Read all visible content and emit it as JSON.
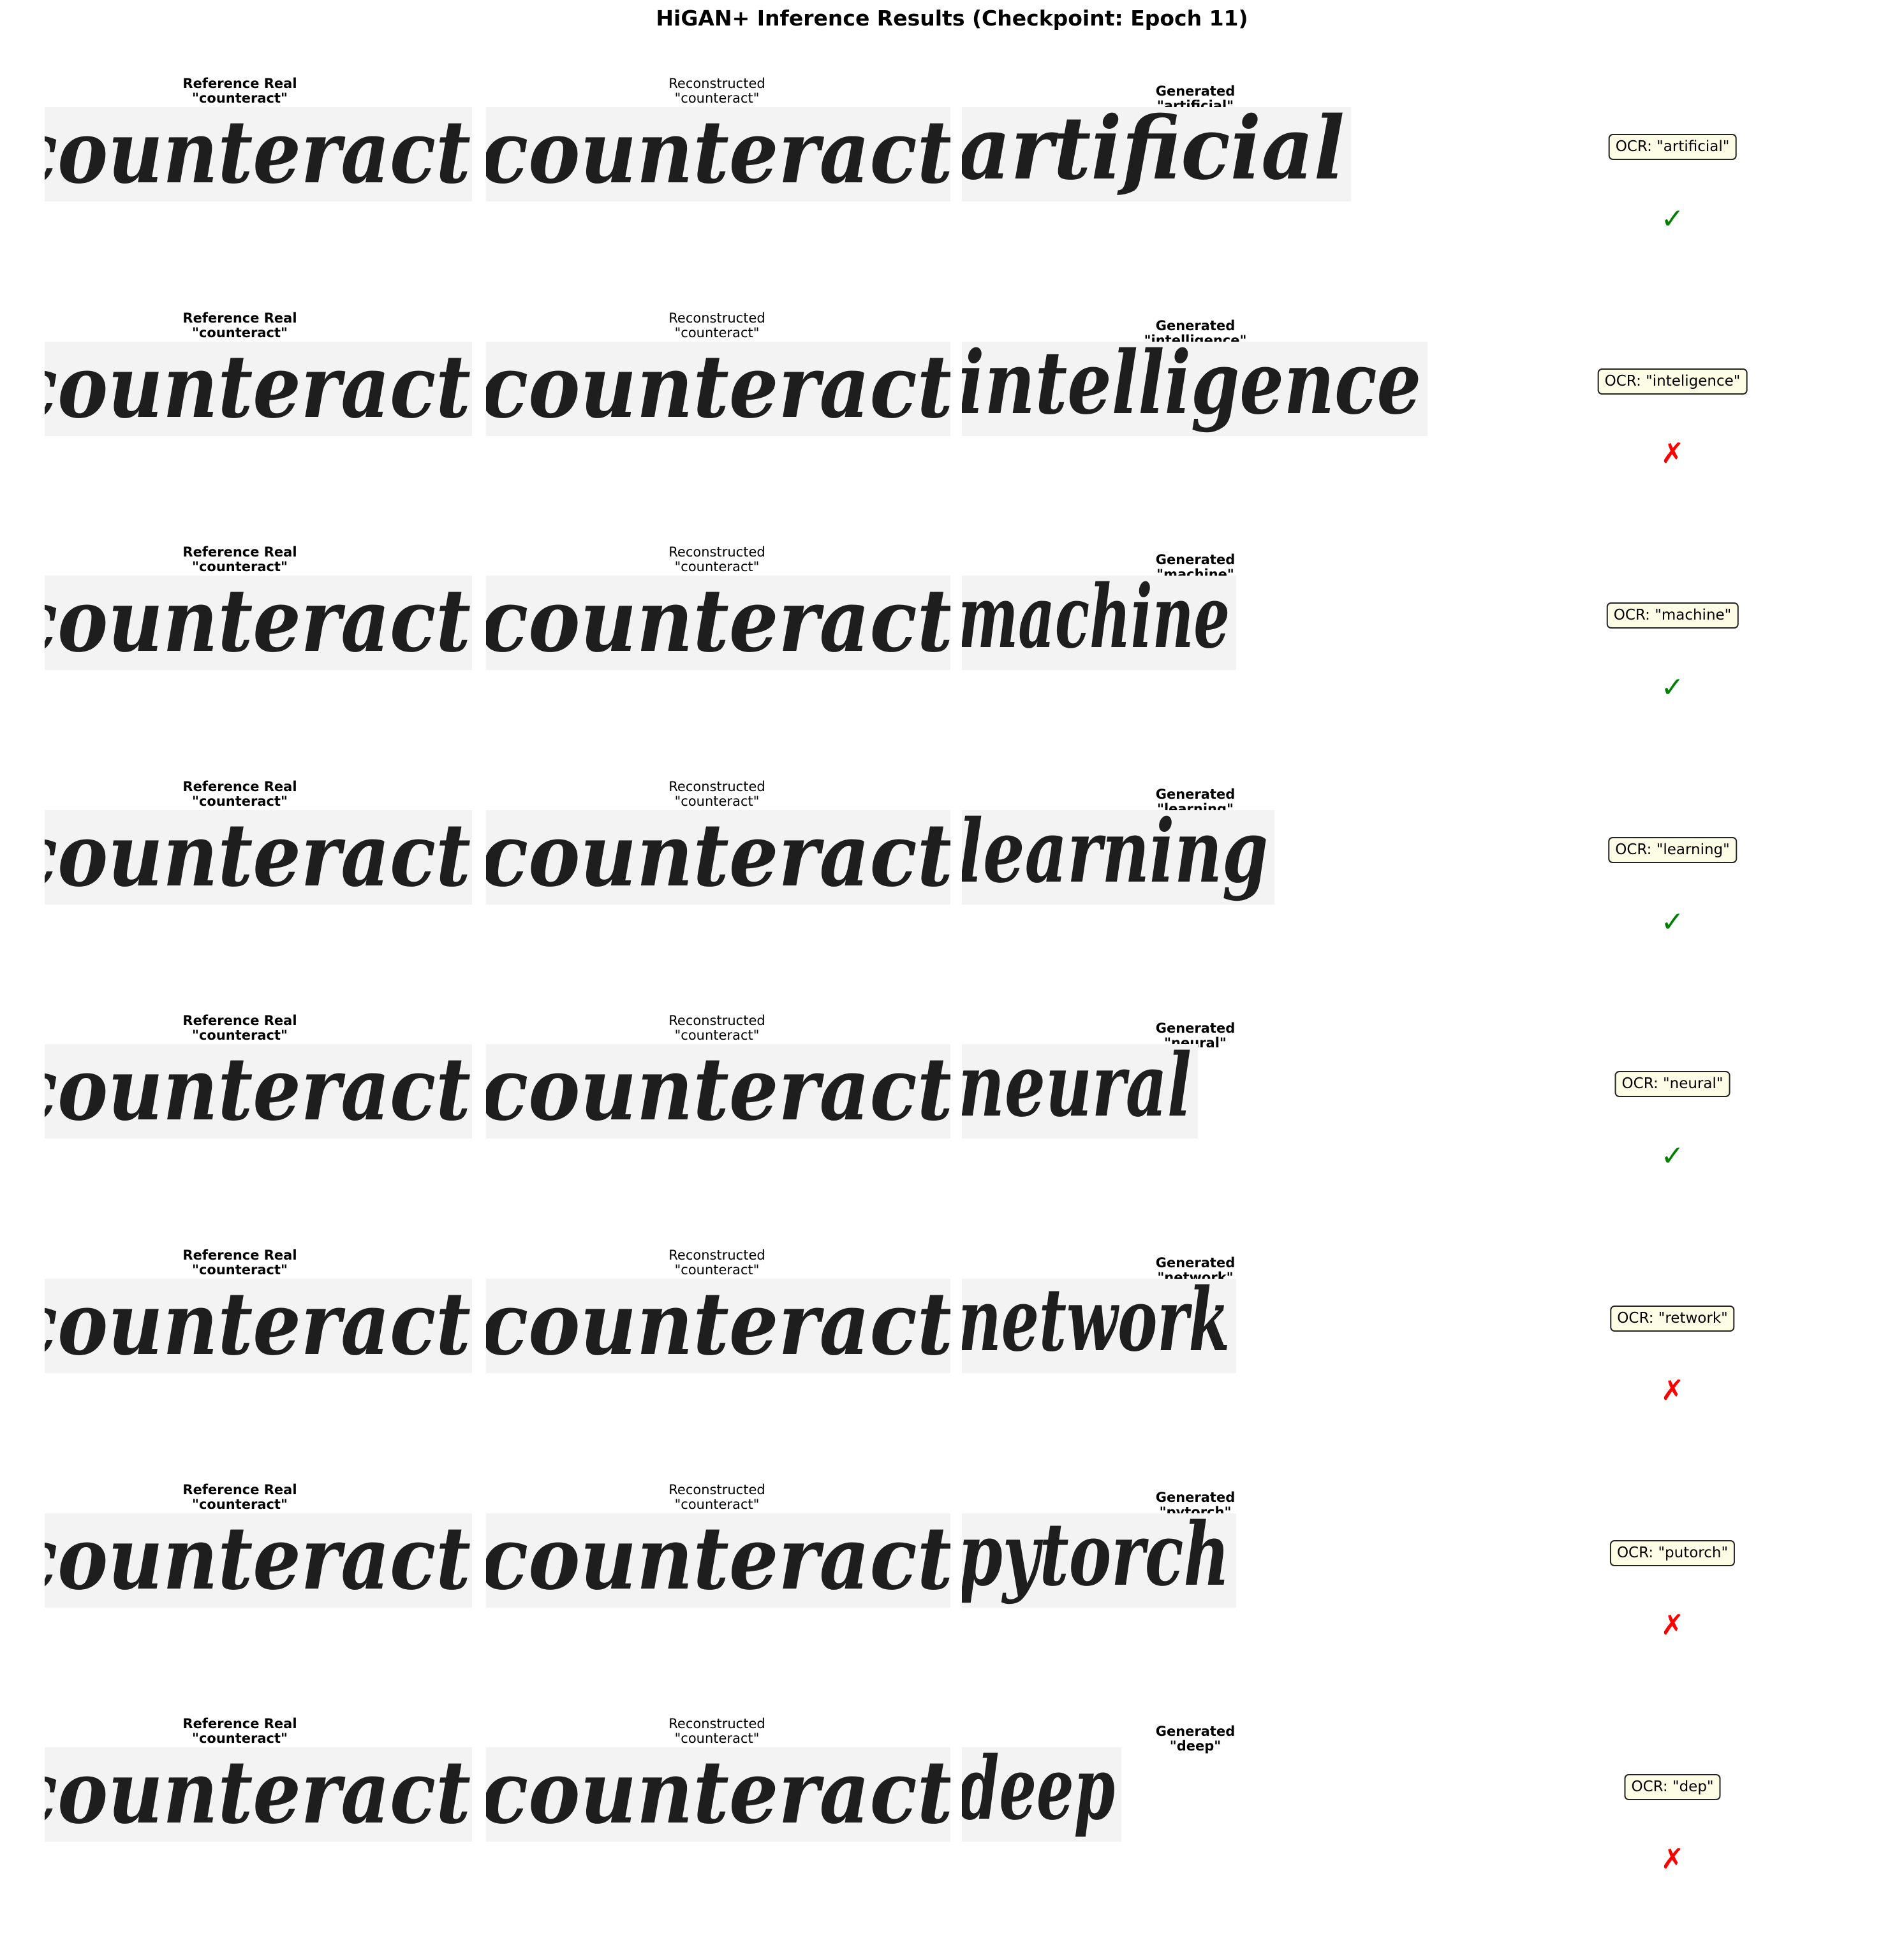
{
  "title": "HiGAN+ Inference Results (Checkpoint: Epoch 11)",
  "colors": {
    "correct": "#008000",
    "incorrect": "#ff0000",
    "ocr_box_bg": "#fdfde6",
    "panel_bg": "#f3f3f3"
  },
  "rows": [
    {
      "ref_label": "Reference Real",
      "ref_word": "\"counteract\"",
      "ref_handwriting": "counteract",
      "rec_label": "Reconstructed",
      "rec_word": "\"counteract\"",
      "rec_handwriting": "counteract",
      "gen_label": "Generated",
      "gen_word": "\"artificial\"",
      "gen_handwriting": "artificial",
      "ocr": "OCR: \"artificial\"",
      "mark": "✓",
      "correct": true
    },
    {
      "ref_label": "Reference Real",
      "ref_word": "\"counteract\"",
      "ref_handwriting": "counteract",
      "rec_label": "Reconstructed",
      "rec_word": "\"counteract\"",
      "rec_handwriting": "counteract",
      "gen_label": "Generated",
      "gen_word": "\"intelligence\"",
      "gen_handwriting": "intelligence",
      "ocr": "OCR: \"inteligence\"",
      "mark": "✗",
      "correct": false
    },
    {
      "ref_label": "Reference Real",
      "ref_word": "\"counteract\"",
      "ref_handwriting": "counteract",
      "rec_label": "Reconstructed",
      "rec_word": "\"counteract\"",
      "rec_handwriting": "counteract",
      "gen_label": "Generated",
      "gen_word": "\"machine\"",
      "gen_handwriting": "machine",
      "ocr": "OCR: \"machine\"",
      "mark": "✓",
      "correct": true
    },
    {
      "ref_label": "Reference Real",
      "ref_word": "\"counteract\"",
      "ref_handwriting": "counteract",
      "rec_label": "Reconstructed",
      "rec_word": "\"counteract\"",
      "rec_handwriting": "counteract",
      "gen_label": "Generated",
      "gen_word": "\"learning\"",
      "gen_handwriting": "learning",
      "ocr": "OCR: \"learning\"",
      "mark": "✓",
      "correct": true
    },
    {
      "ref_label": "Reference Real",
      "ref_word": "\"counteract\"",
      "ref_handwriting": "counteract",
      "rec_label": "Reconstructed",
      "rec_word": "\"counteract\"",
      "rec_handwriting": "counteract",
      "gen_label": "Generated",
      "gen_word": "\"neural\"",
      "gen_handwriting": "neural",
      "ocr": "OCR: \"neural\"",
      "mark": "✓",
      "correct": true
    },
    {
      "ref_label": "Reference Real",
      "ref_word": "\"counteract\"",
      "ref_handwriting": "counteract",
      "rec_label": "Reconstructed",
      "rec_word": "\"counteract\"",
      "rec_handwriting": "counteract",
      "gen_label": "Generated",
      "gen_word": "\"network\"",
      "gen_handwriting": "network",
      "ocr": "OCR: \"retwork\"",
      "mark": "✗",
      "correct": false
    },
    {
      "ref_label": "Reference Real",
      "ref_word": "\"counteract\"",
      "ref_handwriting": "counteract",
      "rec_label": "Reconstructed",
      "rec_word": "\"counteract\"",
      "rec_handwriting": "counteract",
      "gen_label": "Generated",
      "gen_word": "\"pytorch\"",
      "gen_handwriting": "pytorch",
      "ocr": "OCR: \"putorch\"",
      "mark": "✗",
      "correct": false
    },
    {
      "ref_label": "Reference Real",
      "ref_word": "\"counteract\"",
      "ref_handwriting": "counteract",
      "rec_label": "Reconstructed",
      "rec_word": "\"counteract\"",
      "rec_handwriting": "counteract",
      "gen_label": "Generated",
      "gen_word": "\"deep\"",
      "gen_handwriting": "deep",
      "ocr": "OCR: \"dep\"",
      "mark": "✗",
      "correct": false
    }
  ]
}
